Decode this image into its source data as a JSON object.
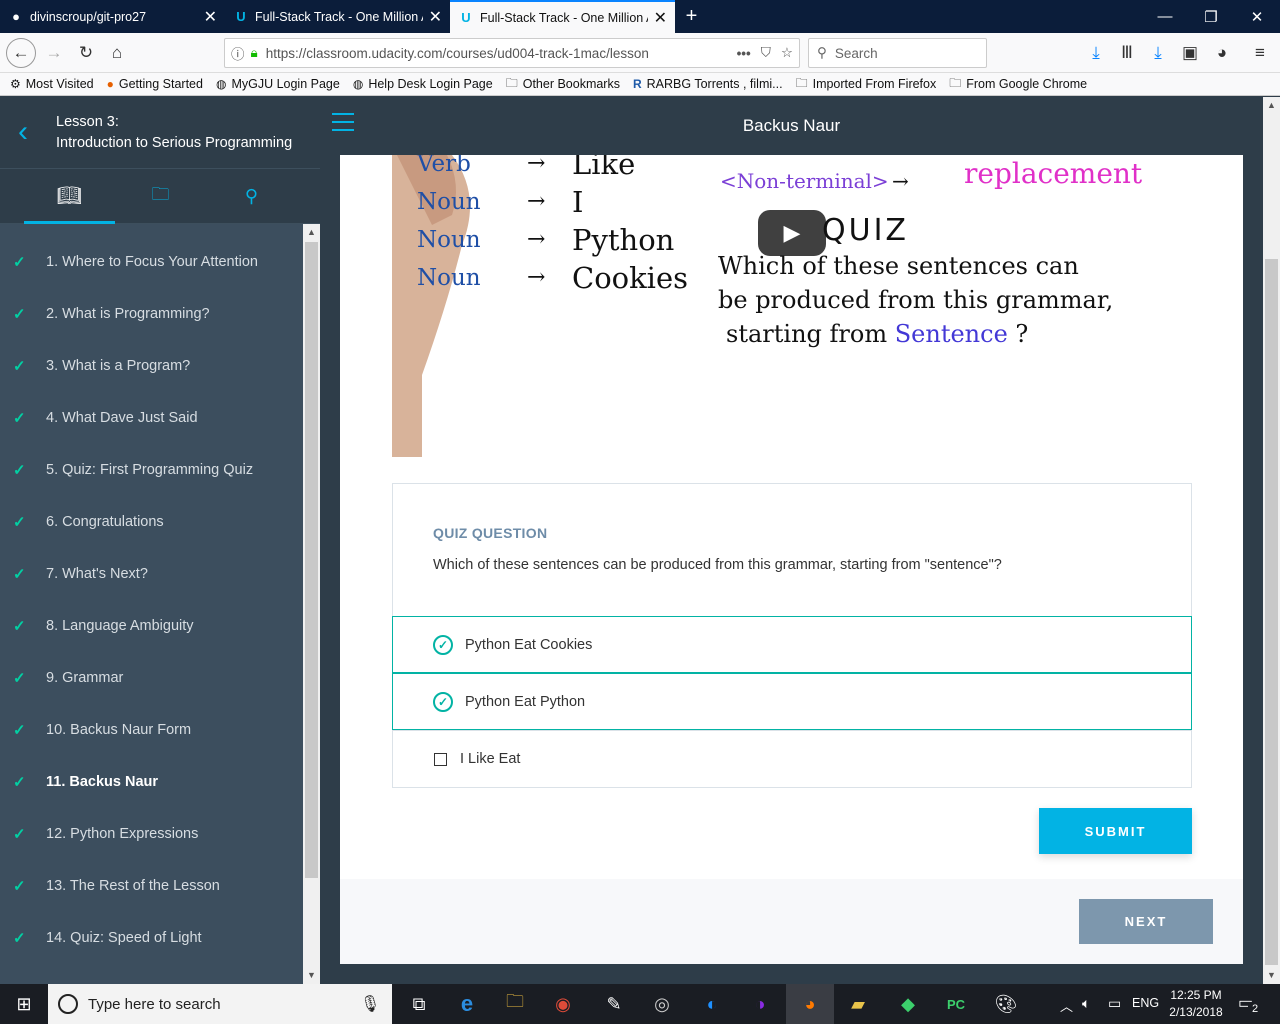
{
  "browser": {
    "tabs": [
      {
        "title": "divinscroup/git-pro27",
        "icon": "github-icon"
      },
      {
        "title": "Full-Stack Track - One Million A",
        "icon": "udacity-icon"
      },
      {
        "title": "Full-Stack Track - One Million A",
        "icon": "udacity-icon"
      }
    ],
    "url": "https://classroom.udacity.com/courses/ud004-track-1mac/lesson",
    "search_placeholder": "Search",
    "bookmarks": [
      {
        "label": "Most Visited",
        "icon": "gear-icon"
      },
      {
        "label": "Getting Started",
        "icon": "firefox-icon"
      },
      {
        "label": "MyGJU Login Page",
        "icon": "globe-icon"
      },
      {
        "label": "Help Desk Login Page",
        "icon": "globe-icon"
      },
      {
        "label": "Other Bookmarks",
        "icon": "folder-icon"
      },
      {
        "label": "RARBG Torrents , filmi...",
        "icon": "r-logo-icon"
      },
      {
        "label": "Imported From Firefox",
        "icon": "folder-icon"
      },
      {
        "label": "From Google Chrome",
        "icon": "folder-icon"
      }
    ]
  },
  "sidebar": {
    "lesson_label": "Lesson 3:",
    "lesson_title": "Introduction to Serious Programming",
    "items": [
      {
        "label": "1. Where to Focus Your Attention"
      },
      {
        "label": "2. What is Programming?"
      },
      {
        "label": "3. What is a Program?"
      },
      {
        "label": "4. What Dave Just Said"
      },
      {
        "label": "5. Quiz: First Programming Quiz"
      },
      {
        "label": "6. Congratulations"
      },
      {
        "label": "7. What's Next?"
      },
      {
        "label": "8. Language Ambiguity"
      },
      {
        "label": "9. Grammar"
      },
      {
        "label": "10. Backus Naur Form"
      },
      {
        "label": "11. Backus Naur"
      },
      {
        "label": "12. Python Expressions"
      },
      {
        "label": "13. The Rest of the Lesson"
      },
      {
        "label": "14. Quiz: Speed of Light"
      }
    ]
  },
  "header": {
    "title": "Backus Naur"
  },
  "video": {
    "left_words": [
      "Verb",
      "Noun",
      "Noun",
      "Noun"
    ],
    "right_words": [
      "Like",
      "I",
      "Python",
      "Cookies"
    ],
    "nonterminal": "<Non-terminal>",
    "replacement": "replacement",
    "quiz_word": "QUIZ",
    "prompt_line1": "Which of these sentences can",
    "prompt_line2": "be produced from this grammar,",
    "prompt_line3a": "starting from",
    "prompt_line3b": "Sentence",
    "prompt_line3c": "?"
  },
  "quiz": {
    "heading": "QUIZ QUESTION",
    "question": "Which of these sentences can be produced from this grammar, starting from \"sentence\"?",
    "options": [
      {
        "label": "Python Eat Cookies",
        "checked": true
      },
      {
        "label": "Python Eat Python",
        "checked": true
      },
      {
        "label": "I Like Eat",
        "checked": false
      }
    ],
    "submit_label": "SUBMIT",
    "next_label": "NEXT"
  },
  "taskbar": {
    "search_placeholder": "Type here to search",
    "lang": "ENG",
    "time": "12:25 PM",
    "date": "2/13/2018",
    "notifications": "2"
  },
  "colors": {
    "accent": "#02b3e4",
    "check": "#02b3a4",
    "sidebar": "#2e3d49"
  }
}
